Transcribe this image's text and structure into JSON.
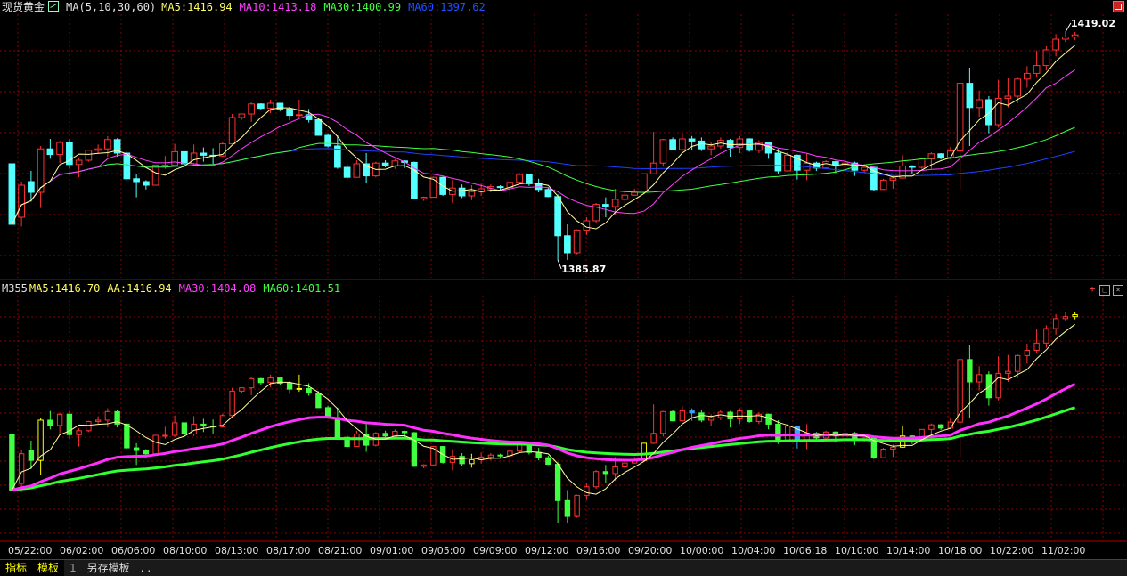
{
  "app": {
    "instrument": "现货黄金",
    "legend_top": {
      "ma_label": "MA(5,10,30,60)",
      "ma5": "MA5:1416.94",
      "ma10": "MA10:1413.18",
      "ma30": "MA30:1400.99",
      "ma60": "MA60:1397.62"
    },
    "legend_bottom": {
      "name": "M355",
      "ma5": "MA5:1416.70",
      "aa": "AA:1416.94",
      "ma30": "MA30:1404.08",
      "ma60": "MA60:1401.51"
    },
    "buttons": {
      "plus": "+",
      "minimize": "□",
      "close": "×"
    },
    "bottom_tabs": [
      "指标",
      "模板",
      "1",
      "另存模板",
      ". ."
    ]
  },
  "colors": {
    "up": "#ff3232",
    "down": "#54ffff",
    "ma5": "#ffffa0",
    "ma10": "#ff40ff",
    "ma30": "#40ff40",
    "ma60": "#2040ff",
    "grid": "#8b0000",
    "axis_text": "#e0e0e0",
    "lower_up": "#ff3232",
    "lower_down": "#40ff40",
    "lower_yellow": "#ffff00",
    "lower_blue": "#40a0ff",
    "lower_ma30": "#ff30ff",
    "lower_ma60": "#30ff30"
  },
  "chart_data": {
    "type": "candlestick",
    "x_labels": [
      "05/22:00",
      "06/02:00",
      "06/06:00",
      "08/10:00",
      "08/13:00",
      "08/17:00",
      "08/21:00",
      "09/01:00",
      "09/05:00",
      "09/09:00",
      "09/12:00",
      "09/16:00",
      "09/20:00",
      "10/00:00",
      "10/04:00",
      "10/06:18",
      "10/10:00",
      "10/14:00",
      "10/18:00",
      "10/22:00",
      "11/02:00"
    ],
    "annotations": [
      {
        "label": "1419.02",
        "value": 1419.02
      },
      {
        "label": "1385.87",
        "value": 1385.87
      }
    ],
    "ohlc": [
      [
        1400.5,
        1399.0,
        1392.4,
        1392.0
      ],
      [
        1393.0,
        1398.0,
        1391.7,
        1397.5
      ],
      [
        1398.0,
        1399.5,
        1395.2,
        1396.5
      ],
      [
        1396.5,
        1403.0,
        1394.3,
        1402.6
      ],
      [
        1402.6,
        1404.0,
        1401.2,
        1401.8
      ],
      [
        1401.8,
        1403.7,
        1400.6,
        1403.5
      ],
      [
        1403.5,
        1404.0,
        1399.8,
        1400.4
      ],
      [
        1400.4,
        1401.4,
        1398.6,
        1401.0
      ],
      [
        1401.0,
        1402.5,
        1400.8,
        1402.4
      ],
      [
        1402.4,
        1403.2,
        1402.0,
        1402.6
      ],
      [
        1402.6,
        1404.4,
        1401.5,
        1403.9
      ],
      [
        1403.9,
        1404.1,
        1401.5,
        1402.0
      ],
      [
        1402.0,
        1402.3,
        1398.1,
        1398.4
      ],
      [
        1398.4,
        1399.1,
        1395.8,
        1398.0
      ],
      [
        1398.0,
        1398.2,
        1396.9,
        1397.5
      ],
      [
        1397.5,
        1400.3,
        1397.5,
        1400.3
      ],
      [
        1400.3,
        1401.6,
        1399.8,
        1400.3
      ],
      [
        1400.3,
        1403.3,
        1400.1,
        1402.2
      ],
      [
        1402.2,
        1402.2,
        1400.1,
        1400.5
      ],
      [
        1400.5,
        1403.2,
        1400.2,
        1402.0
      ],
      [
        1402.0,
        1402.8,
        1400.8,
        1401.7
      ],
      [
        1401.7,
        1402.7,
        1400.5,
        1401.6
      ],
      [
        1401.6,
        1403.6,
        1401.5,
        1403.3
      ],
      [
        1403.3,
        1407.5,
        1403.2,
        1407.0
      ],
      [
        1407.0,
        1407.5,
        1406.7,
        1407.5
      ],
      [
        1407.5,
        1409.1,
        1406.4,
        1408.9
      ],
      [
        1408.9,
        1409.0,
        1408.0,
        1408.3
      ],
      [
        1408.3,
        1409.5,
        1407.6,
        1409.0
      ],
      [
        1409.0,
        1409.0,
        1407.9,
        1408.2
      ],
      [
        1408.2,
        1408.5,
        1406.6,
        1407.3
      ],
      [
        1407.3,
        1409.5,
        1406.9,
        1407.4
      ],
      [
        1407.4,
        1408.2,
        1406.3,
        1406.7
      ],
      [
        1406.7,
        1407.0,
        1404.5,
        1404.5
      ],
      [
        1404.5,
        1404.8,
        1402.8,
        1403.0
      ],
      [
        1403.0,
        1404.5,
        1399.8,
        1400.0
      ],
      [
        1400.0,
        1400.5,
        1398.3,
        1398.6
      ],
      [
        1398.6,
        1401.0,
        1398.6,
        1400.5
      ],
      [
        1400.5,
        1402.0,
        1397.8,
        1398.8
      ],
      [
        1398.8,
        1400.8,
        1398.6,
        1400.6
      ],
      [
        1400.6,
        1401.0,
        1400.0,
        1400.2
      ],
      [
        1400.2,
        1401.2,
        1399.8,
        1400.9
      ],
      [
        1400.9,
        1401.0,
        1399.9,
        1400.7
      ],
      [
        1400.7,
        1400.8,
        1395.5,
        1395.6
      ],
      [
        1395.6,
        1395.9,
        1395.3,
        1395.8
      ],
      [
        1395.8,
        1398.7,
        1395.8,
        1398.6
      ],
      [
        1398.6,
        1398.7,
        1396.0,
        1396.2
      ],
      [
        1396.2,
        1398.2,
        1395.0,
        1397.1
      ],
      [
        1397.1,
        1397.6,
        1395.7,
        1396.0
      ],
      [
        1396.0,
        1397.5,
        1395.4,
        1396.6
      ],
      [
        1396.6,
        1397.7,
        1396.0,
        1397.0
      ],
      [
        1397.0,
        1397.6,
        1396.5,
        1397.3
      ],
      [
        1397.3,
        1397.5,
        1396.8,
        1397.2
      ],
      [
        1397.2,
        1397.9,
        1396.0,
        1397.9
      ],
      [
        1397.9,
        1399.2,
        1397.8,
        1399.0
      ],
      [
        1399.0,
        1399.1,
        1397.4,
        1397.7
      ],
      [
        1397.7,
        1398.4,
        1396.5,
        1396.9
      ],
      [
        1396.9,
        1397.2,
        1395.8,
        1395.9
      ],
      [
        1395.9,
        1396.2,
        1387.0,
        1390.4
      ],
      [
        1390.4,
        1392.0,
        1387.0,
        1388.0
      ],
      [
        1388.0,
        1391.3,
        1387.8,
        1391.2
      ],
      [
        1391.2,
        1393.0,
        1390.5,
        1392.5
      ],
      [
        1392.5,
        1395.0,
        1392.2,
        1394.8
      ],
      [
        1394.8,
        1395.8,
        1393.0,
        1394.5
      ],
      [
        1394.5,
        1397.0,
        1393.4,
        1395.5
      ],
      [
        1395.5,
        1396.5,
        1394.8,
        1396.1
      ],
      [
        1396.1,
        1397.0,
        1396.0,
        1396.5
      ],
      [
        1396.5,
        1399.1,
        1396.4,
        1399.1
      ],
      [
        1399.1,
        1405.0,
        1399.0,
        1400.6
      ],
      [
        1400.6,
        1404.0,
        1400.1,
        1403.9
      ],
      [
        1403.9,
        1404.2,
        1402.4,
        1402.5
      ],
      [
        1402.5,
        1404.7,
        1402.3,
        1404.0
      ],
      [
        1404.0,
        1404.4,
        1402.5,
        1403.7
      ],
      [
        1403.7,
        1404.2,
        1402.3,
        1402.6
      ],
      [
        1402.6,
        1403.5,
        1401.7,
        1403.0
      ],
      [
        1403.0,
        1404.2,
        1402.6,
        1403.8
      ],
      [
        1403.8,
        1404.0,
        1401.5,
        1402.8
      ],
      [
        1402.8,
        1404.4,
        1402.0,
        1404.0
      ],
      [
        1404.0,
        1404.1,
        1402.2,
        1402.4
      ],
      [
        1402.4,
        1403.8,
        1402.0,
        1403.5
      ],
      [
        1403.5,
        1403.6,
        1401.2,
        1402.0
      ],
      [
        1402.0,
        1402.6,
        1399.0,
        1399.5
      ],
      [
        1399.5,
        1402.1,
        1399.4,
        1401.7
      ],
      [
        1401.7,
        1401.8,
        1398.3,
        1399.6
      ],
      [
        1399.6,
        1402.0,
        1398.2,
        1400.6
      ],
      [
        1400.6,
        1400.8,
        1399.5,
        1399.9
      ],
      [
        1399.9,
        1401.0,
        1399.8,
        1400.8
      ],
      [
        1400.8,
        1400.9,
        1399.2,
        1400.4
      ],
      [
        1400.4,
        1401.1,
        1400.0,
        1400.6
      ],
      [
        1400.6,
        1400.8,
        1398.8,
        1399.6
      ],
      [
        1399.6,
        1400.3,
        1399.2,
        1400.0
      ],
      [
        1400.0,
        1400.2,
        1396.7,
        1396.9
      ],
      [
        1396.9,
        1398.4,
        1396.9,
        1398.2
      ],
      [
        1398.2,
        1398.9,
        1397.0,
        1398.5
      ],
      [
        1398.5,
        1401.7,
        1398.4,
        1400.2
      ],
      [
        1400.2,
        1400.3,
        1399.0,
        1400.0
      ],
      [
        1400.0,
        1400.5,
        1399.8,
        1401.2
      ],
      [
        1401.2,
        1402.1,
        1399.8,
        1401.9
      ],
      [
        1401.9,
        1402.0,
        1401.1,
        1401.4
      ],
      [
        1401.4,
        1402.9,
        1401.4,
        1402.3
      ],
      [
        1402.3,
        1402.4,
        1396.9,
        1411.8
      ],
      [
        1411.8,
        1414.0,
        1403.0,
        1408.4
      ],
      [
        1408.4,
        1410.8,
        1407.1,
        1409.5
      ],
      [
        1409.5,
        1410.0,
        1404.8,
        1406.0
      ],
      [
        1406.0,
        1412.3,
        1405.6,
        1409.7
      ],
      [
        1409.7,
        1412.5,
        1408.4,
        1410.0
      ],
      [
        1410.0,
        1412.6,
        1409.0,
        1412.4
      ],
      [
        1412.4,
        1414.2,
        1411.2,
        1413.2
      ],
      [
        1413.2,
        1416.4,
        1412.7,
        1414.3
      ],
      [
        1414.3,
        1417.0,
        1413.6,
        1416.5
      ],
      [
        1416.5,
        1418.7,
        1415.6,
        1418.0
      ],
      [
        1418.0,
        1419.0,
        1417.6,
        1418.3
      ],
      [
        1418.3,
        1419.0,
        1417.9,
        1418.6
      ]
    ]
  }
}
